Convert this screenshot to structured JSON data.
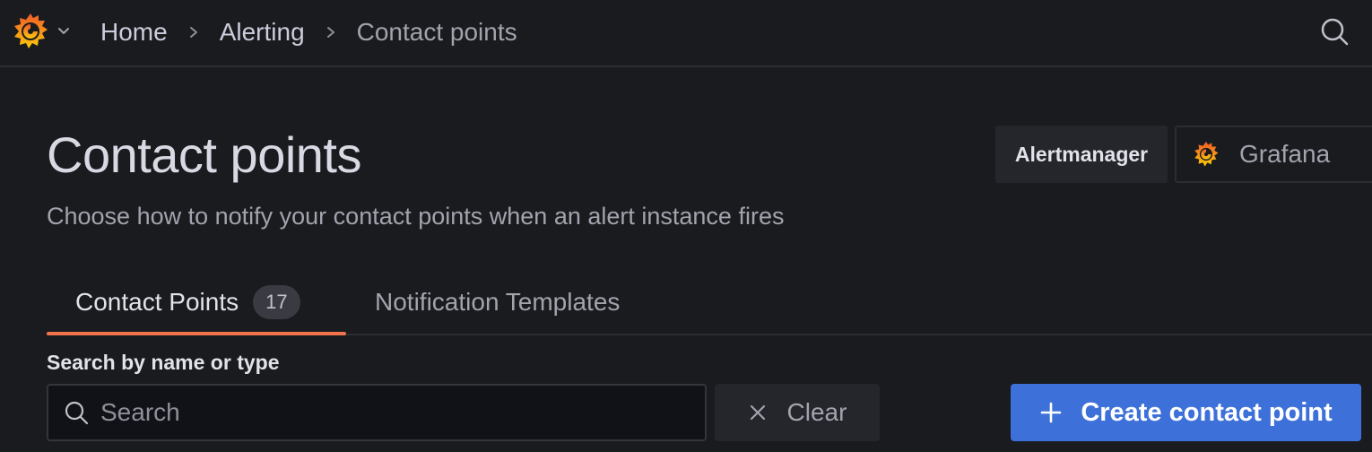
{
  "topbar": {
    "logo_icon": "grafana-logo-icon",
    "menu_icon": "chevron-down-icon",
    "breadcrumbs": [
      "Home",
      "Alerting",
      "Contact points"
    ],
    "search_icon": "search-icon"
  },
  "header": {
    "title": "Contact points",
    "subtitle": "Choose how to notify your contact points when an alert instance fires"
  },
  "alertmanager": {
    "label": "Alertmanager",
    "selected": "Grafana"
  },
  "tabs": [
    {
      "label": "Contact Points",
      "count": "17",
      "active": true
    },
    {
      "label": "Notification Templates",
      "active": false
    }
  ],
  "search": {
    "label": "Search by name or type",
    "placeholder": "Search",
    "value": ""
  },
  "actions": {
    "clear_label": "Clear",
    "create_label": "Create contact point"
  },
  "colors": {
    "background": "#1a1b1f",
    "accent_orange": "#f0734c",
    "primary_blue": "#3d71d9"
  }
}
